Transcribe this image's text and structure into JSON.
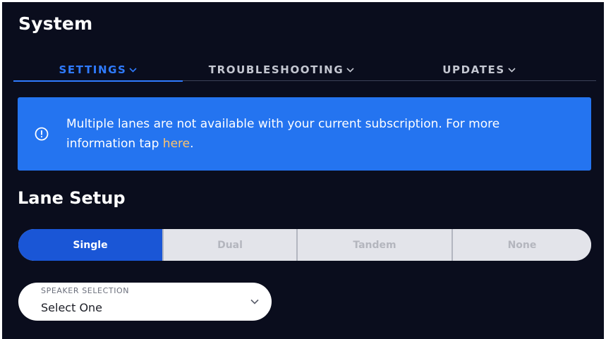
{
  "page": {
    "title": "System"
  },
  "tabs": [
    {
      "label": "SETTINGS",
      "active": true,
      "icon": "chevron-down-icon"
    },
    {
      "label": "TROUBLESHOOTING",
      "active": false,
      "icon": "chevron-down-icon"
    },
    {
      "label": "UPDATES",
      "active": false,
      "icon": "chevron-down-icon"
    }
  ],
  "alert": {
    "icon": "info-circle-icon",
    "text": "Multiple lanes are not available with your current subscription. For more information tap ",
    "link_text": "here",
    "suffix": ".",
    "background": "#2474f0",
    "link_color": "#ffc46a"
  },
  "lane_setup": {
    "title": "Lane Setup",
    "options": [
      "Single",
      "Dual",
      "Tandem",
      "None"
    ],
    "selected": "Single",
    "selected_color": "#1a56d6"
  },
  "speaker_selection": {
    "label": "SPEAKER SELECTION",
    "value": "Select One",
    "icon": "chevron-down-icon"
  },
  "colors": {
    "background": "#0a0d1d",
    "accent": "#2f7bff"
  }
}
